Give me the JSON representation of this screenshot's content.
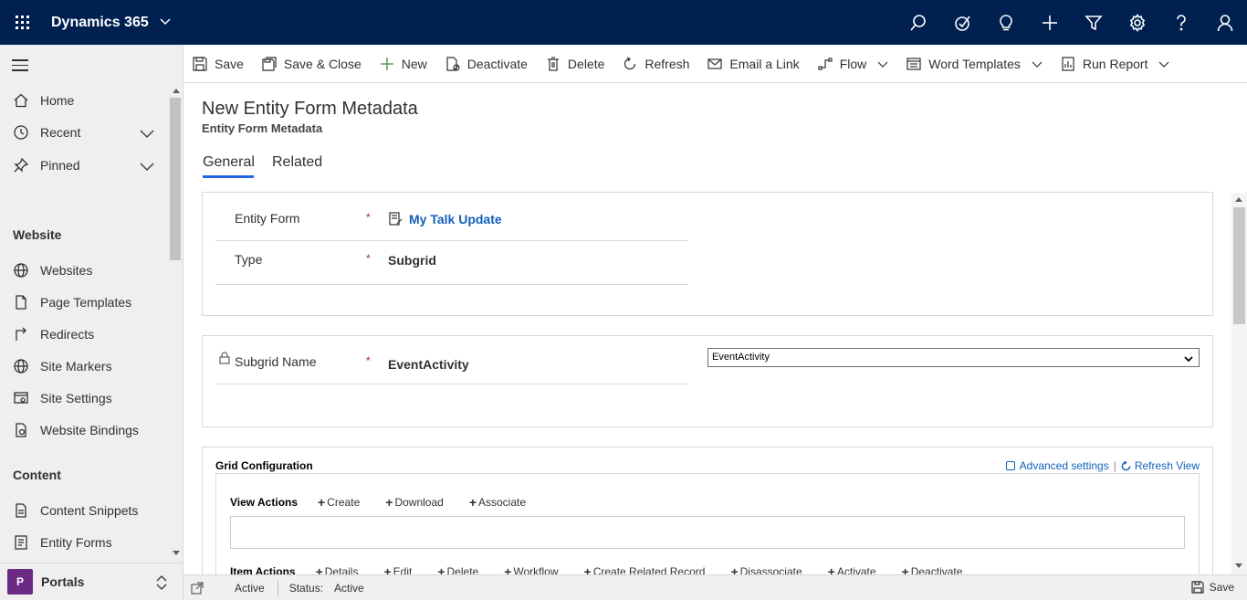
{
  "topbar": {
    "app_title": "Dynamics 365",
    "icons": [
      "search-icon",
      "task-icon",
      "lightbulb-icon",
      "plus-icon",
      "filter-icon",
      "settings-icon",
      "help-icon",
      "user-icon"
    ]
  },
  "sidebar": {
    "items": [
      {
        "label": "Home",
        "icon": "home-icon"
      },
      {
        "label": "Recent",
        "icon": "clock-icon"
      },
      {
        "label": "Pinned",
        "icon": "pin-icon"
      }
    ],
    "groups": [
      {
        "title": "Website",
        "items": [
          {
            "label": "Websites",
            "icon": "globe-icon"
          },
          {
            "label": "Page Templates",
            "icon": "page-icon"
          },
          {
            "label": "Redirects",
            "icon": "redirect-icon"
          },
          {
            "label": "Site Markers",
            "icon": "globe-icon"
          },
          {
            "label": "Site Settings",
            "icon": "settings-page-icon"
          },
          {
            "label": "Website Bindings",
            "icon": "binding-icon"
          }
        ]
      },
      {
        "title": "Content",
        "items": [
          {
            "label": "Content Snippets",
            "icon": "snippet-icon"
          },
          {
            "label": "Entity Forms",
            "icon": "form-icon"
          }
        ]
      }
    ],
    "area": {
      "badge": "P",
      "label": "Portals"
    }
  },
  "toolbar": {
    "save": "Save",
    "save_close": "Save & Close",
    "new": "New",
    "deactivate": "Deactivate",
    "delete": "Delete",
    "refresh": "Refresh",
    "email_link": "Email a Link",
    "flow": "Flow",
    "word_templates": "Word Templates",
    "run_report": "Run Report"
  },
  "form": {
    "title": "New Entity Form Metadata",
    "subtitle": "Entity Form Metadata",
    "tabs": [
      "General",
      "Related"
    ],
    "section1": {
      "entity_form_label": "Entity Form",
      "entity_form_value": "My Talk Update",
      "type_label": "Type",
      "type_value": "Subgrid",
      "required_marker": "*"
    },
    "section2": {
      "subgrid_name_label": "Subgrid Name",
      "subgrid_name_value": "EventActivity",
      "select_value": "EventActivity",
      "required_marker": "*"
    },
    "grid_config": {
      "title": "Grid Configuration",
      "advanced_settings": "Advanced settings",
      "separator": "|",
      "refresh_view": "Refresh View",
      "view_actions": {
        "label": "View Actions",
        "buttons": [
          "Create",
          "Download",
          "Associate"
        ]
      },
      "item_actions": {
        "label": "Item Actions",
        "buttons": [
          "Details",
          "Edit",
          "Delete",
          "Workflow",
          "Create Related Record",
          "Disassociate",
          "Activate",
          "Deactivate"
        ]
      }
    }
  },
  "statusbar": {
    "state": "Active",
    "status_label": "Status:",
    "status_value": "Active",
    "save": "Save"
  },
  "colors": {
    "topbar_bg": "#002050",
    "link": "#1160b7",
    "tab_underline": "#2266e3",
    "required": "#a4262c",
    "area_badge": "#6b2a84"
  }
}
